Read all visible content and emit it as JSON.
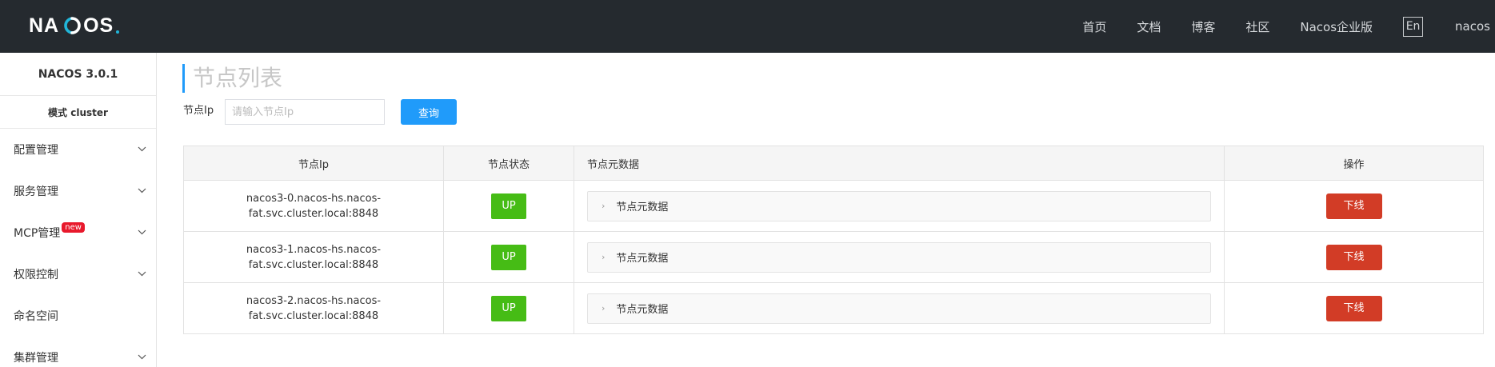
{
  "header": {
    "logo_text_left": "NA",
    "logo_text_right": "OS",
    "nav": [
      "首页",
      "文档",
      "博客",
      "社区",
      "Nacos企业版"
    ],
    "lang": "En",
    "user": "nacos"
  },
  "sidebar": {
    "version": "NACOS 3.0.1",
    "mode": "模式 cluster",
    "items": [
      {
        "label": "配置管理"
      },
      {
        "label": "服务管理"
      },
      {
        "label": "MCP管理",
        "badge": "new"
      },
      {
        "label": "权限控制"
      },
      {
        "label": "命名空间"
      },
      {
        "label": "集群管理"
      }
    ]
  },
  "main": {
    "title": "节点列表",
    "filter": {
      "label": "节点Ip",
      "placeholder": "请输入节点Ip",
      "value": "",
      "query_label": "查询"
    },
    "table": {
      "columns": [
        "节点Ip",
        "节点状态",
        "节点元数据",
        "操作"
      ],
      "rows": [
        {
          "ip_line1": "nacos3-0.nacos-hs.nacos-",
          "ip_line2": "fat.svc.cluster.local:8848",
          "status": "UP",
          "meta": "节点元数据",
          "action": "下线"
        },
        {
          "ip_line1": "nacos3-1.nacos-hs.nacos-",
          "ip_line2": "fat.svc.cluster.local:8848",
          "status": "UP",
          "meta": "节点元数据",
          "action": "下线"
        },
        {
          "ip_line1": "nacos3-2.nacos-hs.nacos-",
          "ip_line2": "fat.svc.cluster.local:8848",
          "status": "UP",
          "meta": "节点元数据",
          "action": "下线"
        }
      ]
    }
  },
  "colors": {
    "header_bg": "#252a2f",
    "accent": "#209bfa",
    "status_up": "#46bc15",
    "danger": "#d23c26",
    "badge": "#e8192c"
  },
  "icons": {
    "logo_mark": "nacos-logo-icon",
    "chevron": "chevron-down-icon",
    "expand": "chevron-right-icon"
  }
}
